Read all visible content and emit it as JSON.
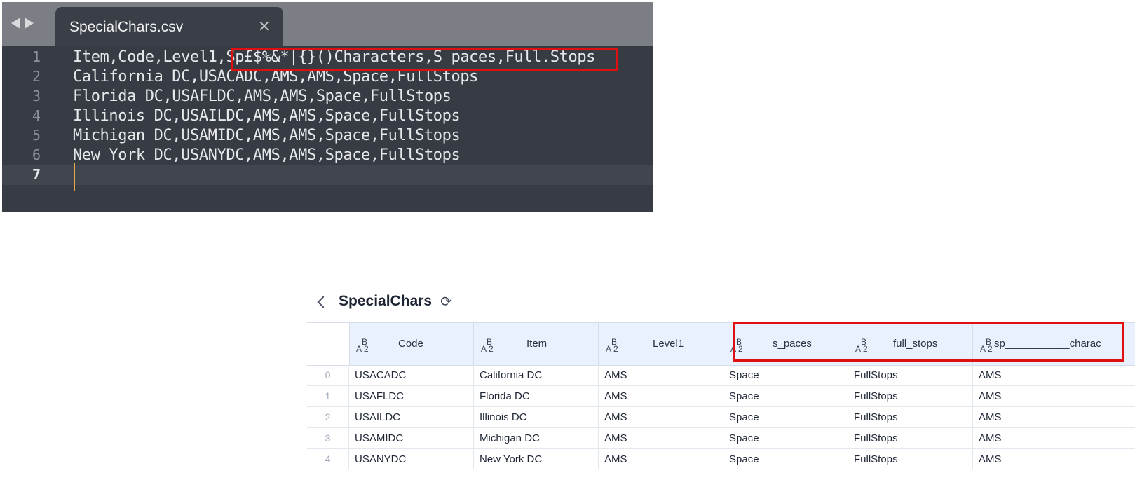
{
  "editor": {
    "tab_title": "SpecialChars.csv",
    "tab_close": "×",
    "lines": [
      {
        "num": "1",
        "text": "Item,Code,Level1,Sp£$%&*|{}()Characters,S paces,Full.Stops"
      },
      {
        "num": "2",
        "text": "California DC,USACADC,AMS,AMS,Space,FullStops"
      },
      {
        "num": "3",
        "text": "Florida DC,USAFLDC,AMS,AMS,Space,FullStops"
      },
      {
        "num": "4",
        "text": "Illinois DC,USAILDC,AMS,AMS,Space,FullStops"
      },
      {
        "num": "5",
        "text": "Michigan DC,USAMIDC,AMS,AMS,Space,FullStops"
      },
      {
        "num": "6",
        "text": "New York DC,USANYDC,AMS,AMS,Space,FullStops"
      },
      {
        "num": "7",
        "text": ""
      }
    ],
    "active_line": "7",
    "highlight_color": "#e01010"
  },
  "preview": {
    "title": "SpecialChars",
    "refresh_icon": "refresh-icon",
    "type_icon_letters": {
      "b": "B",
      "a": "A",
      "two": "2"
    },
    "columns": [
      {
        "name": "Code"
      },
      {
        "name": "Item"
      },
      {
        "name": "Level1"
      },
      {
        "name": "s_paces"
      },
      {
        "name": "full_stops"
      },
      {
        "name": "sp___________charac"
      }
    ],
    "rows": [
      {
        "index": "0",
        "cells": [
          "USACADC",
          "California DC",
          "AMS",
          "Space",
          "FullStops",
          "AMS"
        ]
      },
      {
        "index": "1",
        "cells": [
          "USAFLDC",
          "Florida DC",
          "AMS",
          "Space",
          "FullStops",
          "AMS"
        ]
      },
      {
        "index": "2",
        "cells": [
          "USAILDC",
          "Illinois DC",
          "AMS",
          "Space",
          "FullStops",
          "AMS"
        ]
      },
      {
        "index": "3",
        "cells": [
          "USAMIDC",
          "Michigan DC",
          "AMS",
          "Space",
          "FullStops",
          "AMS"
        ]
      },
      {
        "index": "4",
        "cells": [
          "USANYDC",
          "New York DC",
          "AMS",
          "Space",
          "FullStops",
          "AMS"
        ]
      }
    ]
  }
}
